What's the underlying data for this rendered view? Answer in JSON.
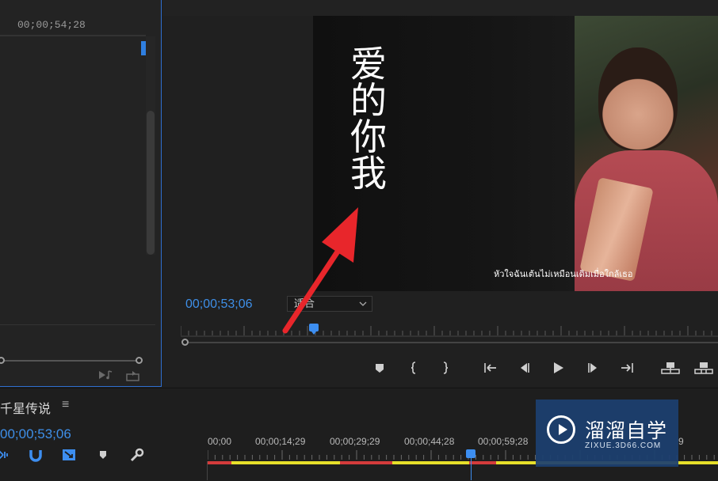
{
  "source_panel": {
    "timecode": "00;00;54;28",
    "footer_icons": [
      "insert-audio-icon",
      "export-frame-icon"
    ]
  },
  "program_monitor": {
    "video_title_chars": [
      "爱",
      "的",
      "你",
      "我"
    ],
    "subtitle": "หัวใจฉันเต้นไม่เหมือนเดิมเมื่อใกล้เธอ",
    "timecode": "00;00;53;06",
    "fit_dropdown": {
      "selected": "适合"
    },
    "transport_buttons": [
      "add-marker",
      "mark-in",
      "mark-out",
      "go-to-in",
      "step-back",
      "play",
      "step-forward",
      "go-to-out",
      "lift",
      "extract"
    ]
  },
  "timeline": {
    "sequence_name": "千星传说",
    "menu_icon": "≡",
    "timecode": "00;00;53;06",
    "tools": [
      "ripple-icon",
      "magnet-icon",
      "linked-selection-icon",
      "marker-icon",
      "wrench-icon"
    ],
    "ruler_labels": [
      "00;00",
      "00;00;14;29",
      "00;00;29;29",
      "00;00;44;28",
      "00;00;59;28",
      "9"
    ]
  },
  "watermark": {
    "title": "溜溜自学",
    "url": "ZIXUE.3D66.COM"
  },
  "colors": {
    "accent_blue": "#3e8fe8",
    "workbar_yellow": "#e6df2a",
    "render_red": "#d43b3b",
    "annotation_red": "#e8262b"
  }
}
